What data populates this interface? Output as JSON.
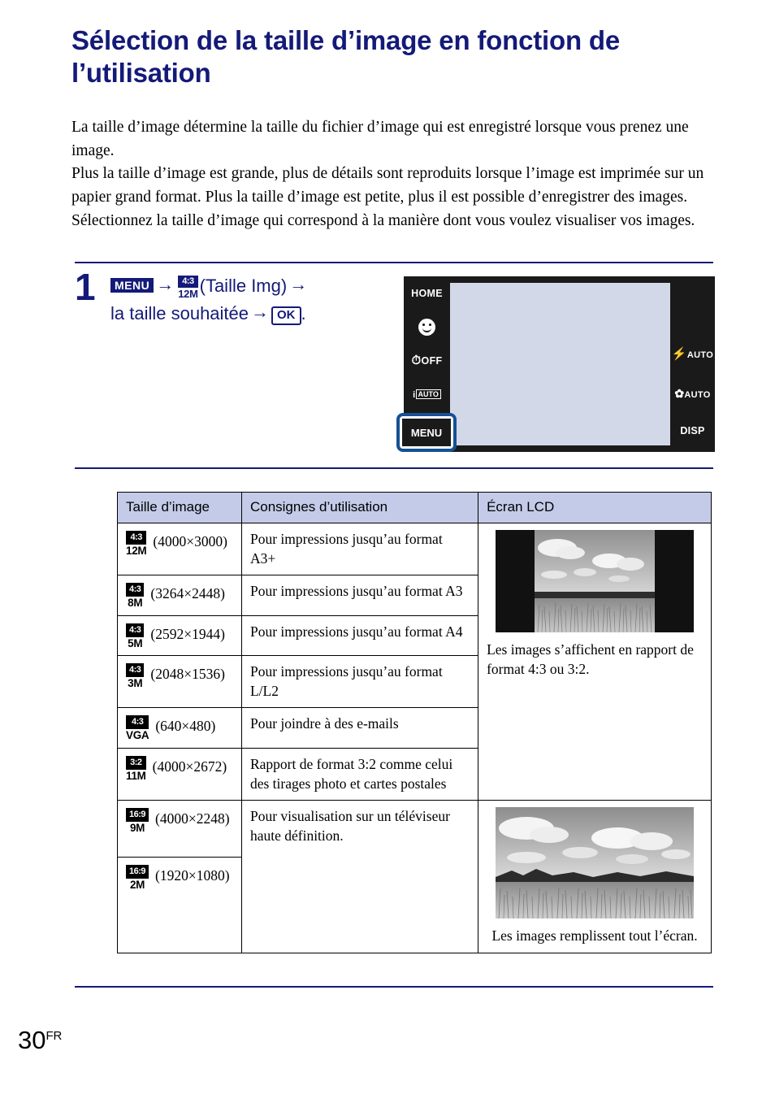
{
  "page": {
    "title": "Sélection de la taille d’image en fonction de l’utilisation",
    "number": "30",
    "lang_suffix": "FR"
  },
  "intro": {
    "p1": "La taille d’image détermine la taille du fichier d’image qui est enregistré lorsque vous prenez une image.",
    "p2": "Plus la taille d’image est grande, plus de détails sont reproduits lorsque l’image est imprimée sur un papier grand format. Plus la taille d’image est petite, plus il est possible d’enregistrer des images. Sélectionnez la taille d’image qui correspond à la manière dont vous voulez visualiser vos images."
  },
  "step": {
    "number": "1",
    "menu_badge": "MENU",
    "arrow": "→",
    "icon_ratio": "4:3",
    "icon_mp": "12M",
    "label_taille_img": "(Taille Img)",
    "line2_text": "la taille souhaitée",
    "ok_badge": "OK",
    "period": "."
  },
  "lcd_illustration": {
    "left_buttons": [
      {
        "name": "home",
        "label": "HOME"
      },
      {
        "name": "smile-detection",
        "label": ""
      },
      {
        "name": "self-timer-off",
        "label": "OFF"
      },
      {
        "name": "intelligent-auto",
        "label": "AUTO"
      }
    ],
    "right_buttons": [
      {
        "name": "flash-auto",
        "label": "AUTO"
      },
      {
        "name": "macro-auto",
        "label": "AUTO"
      },
      {
        "name": "display",
        "label": "DISP"
      }
    ],
    "menu_button": "MENU"
  },
  "table": {
    "headers": [
      "Taille d’image",
      "Consignes d’utilisation",
      "Écran LCD"
    ],
    "rows": [
      {
        "ratio": "4:3",
        "mp": "12M",
        "dims": "(4000×3000)",
        "usage": "Pour impressions jusqu’au format A3+"
      },
      {
        "ratio": "4:3",
        "mp": "8M",
        "dims": "(3264×2448)",
        "usage": "Pour impressions jusqu’au format A3"
      },
      {
        "ratio": "4:3",
        "mp": "5M",
        "dims": "(2592×1944)",
        "usage": "Pour impressions jusqu’au format A4"
      },
      {
        "ratio": "4:3",
        "mp": "3M",
        "dims": "(2048×1536)",
        "usage": "Pour impressions jusqu’au format L/L2"
      },
      {
        "ratio": "4:3",
        "mp": "VGA",
        "dims": "(640×480)",
        "usage": "Pour joindre à des e-mails"
      },
      {
        "ratio": "3:2",
        "mp": "11M",
        "dims": "(4000×2672)",
        "usage": "Rapport de format 3:2 comme celui des tirages photo et cartes postales"
      },
      {
        "ratio": "16:9",
        "mp": "9M",
        "dims": "(4000×2248)",
        "usage": "Pour visualisation sur un téléviseur haute définition."
      },
      {
        "ratio": "16:9",
        "mp": "2M",
        "dims": "(1920×1080)",
        "usage": ""
      }
    ],
    "lcd_caption_1": "Les images s’affichent en rapport de format 4:3 ou 3:2.",
    "lcd_caption_2": "Les images remplissent tout l’écran."
  },
  "colors": {
    "brand_navy": "#141a78",
    "header_fill": "#c3cbe8",
    "lcd_screen": "#d3d8e8",
    "highlight_blue": "#155194"
  }
}
